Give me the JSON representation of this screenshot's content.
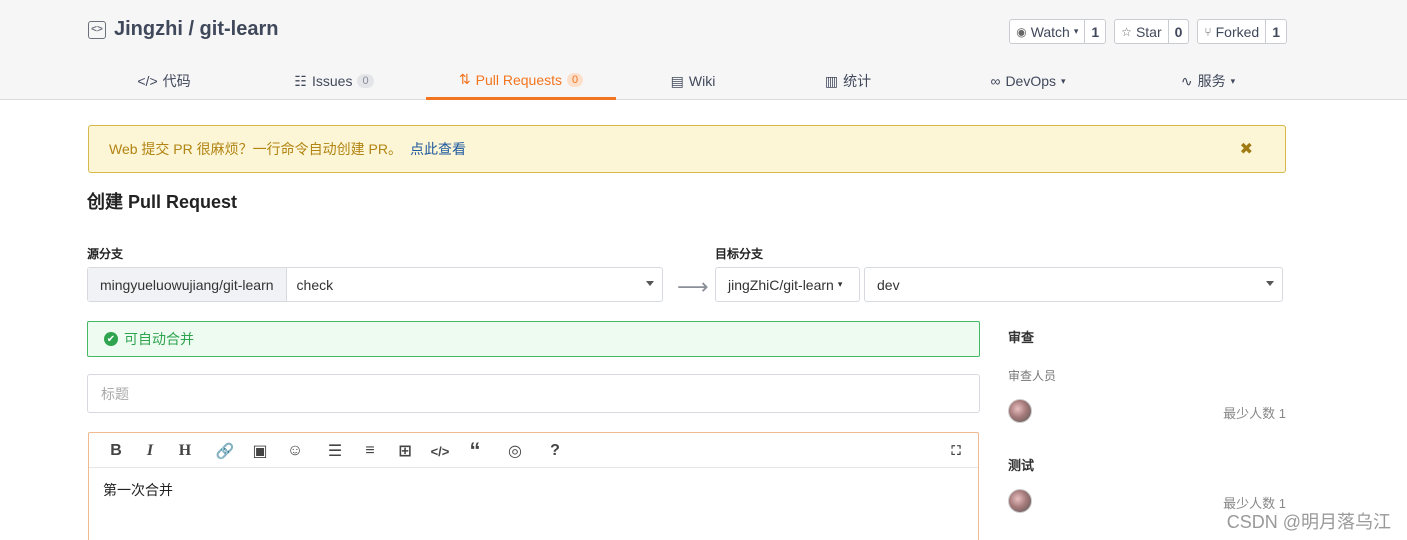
{
  "repo": {
    "title": "Jingzhi / git-learn",
    "icon": "code-repo-icon"
  },
  "actions": [
    {
      "icon": "eye-icon",
      "label": "Watch",
      "count": "1"
    },
    {
      "icon": "star-icon",
      "label": "Star",
      "count": "0"
    },
    {
      "icon": "fork-icon",
      "label": "Forked",
      "count": "1"
    }
  ],
  "tabs": {
    "code": "代码",
    "issues": "Issues",
    "issues_count": "0",
    "pull_requests": "Pull Requests",
    "pull_requests_count": "0",
    "wiki": "Wiki",
    "stats": "统计",
    "devops": "DevOps",
    "services": "服务"
  },
  "notice": {
    "text": "Web 提交 PR 很麻烦？一行命令自动创建 PR。",
    "link": "点此查看",
    "close": "✖"
  },
  "page_title": "创建 Pull Request",
  "source": {
    "label": "源分支",
    "repo": "mingyueluowujiang/git-learn",
    "branch": "check"
  },
  "target": {
    "label": "目标分支",
    "repo": "jingZhiC/git-learn",
    "branch": "dev"
  },
  "merge_status": "可自动合并",
  "title_input": {
    "placeholder": "标题",
    "value": ""
  },
  "editor": {
    "toolbar": [
      "B",
      "I",
      "H",
      "link-icon",
      "image-icon",
      "emoji-icon",
      "bulleted-list-icon",
      "numbered-list-icon",
      "table-icon",
      "code-icon",
      "quote-icon",
      "preview-icon",
      "help-icon",
      "fullscreen-icon"
    ],
    "content": "第一次合并"
  },
  "sidebar": {
    "review_title": "审查",
    "reviewers_label": "审查人员",
    "review_min": "最少人数 1",
    "test_title": "测试",
    "test_min": "最少人数 1"
  },
  "watermark": "CSDN @明月落乌江",
  "colors": {
    "accent": "#f3751f",
    "success": "#2ea44f",
    "notice_bg": "#fcf5d6"
  }
}
